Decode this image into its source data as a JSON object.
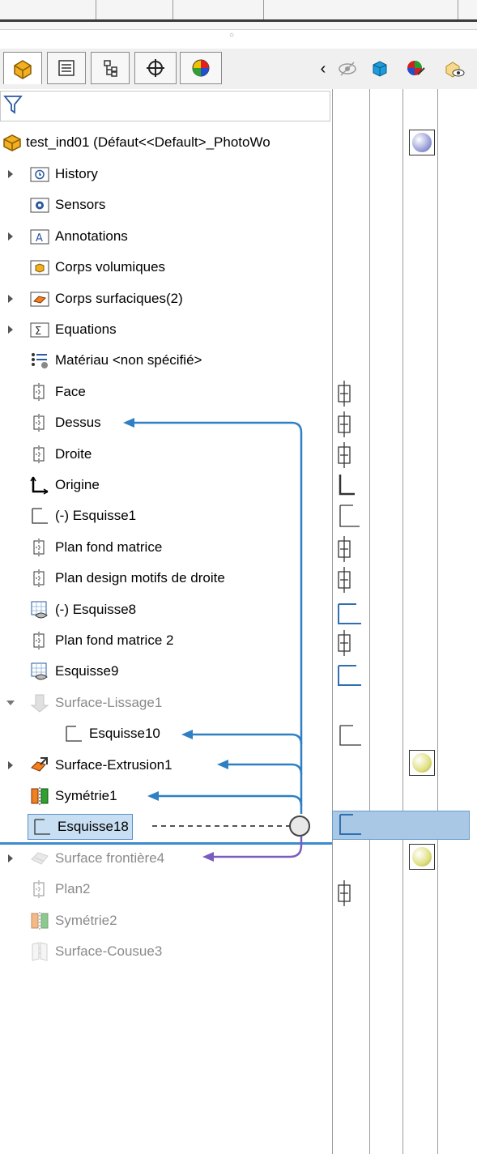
{
  "tree": {
    "root": "test_ind01  (Défaut<<Default>_PhotoWo",
    "items": [
      {
        "label": "History",
        "icon": "history-folder-icon",
        "expand": true
      },
      {
        "label": "Sensors",
        "icon": "sensors-folder-icon",
        "expand": false
      },
      {
        "label": "Annotations",
        "icon": "annotations-folder-icon",
        "expand": true
      },
      {
        "label": "Corps volumiques",
        "icon": "solid-bodies-folder-icon",
        "expand": false
      },
      {
        "label": "Corps surfaciques(2)",
        "icon": "surface-bodies-folder-icon",
        "expand": true
      },
      {
        "label": "Equations",
        "icon": "equations-folder-icon",
        "expand": true
      },
      {
        "label": "Matériau <non spécifié>",
        "icon": "material-icon",
        "expand": false
      },
      {
        "label": "Face",
        "icon": "plane-icon",
        "expand": false
      },
      {
        "label": "Dessus",
        "icon": "plane-icon",
        "expand": false
      },
      {
        "label": "Droite",
        "icon": "plane-icon",
        "expand": false
      },
      {
        "label": "Origine",
        "icon": "origin-icon",
        "expand": false
      },
      {
        "label": "(-) Esquisse1",
        "icon": "sketch-icon",
        "expand": false
      },
      {
        "label": "Plan fond matrice",
        "icon": "plane-icon",
        "expand": false
      },
      {
        "label": "Plan design motifs de droite",
        "icon": "plane-icon",
        "expand": false
      },
      {
        "label": "(-) Esquisse8",
        "icon": "sketch-3d-icon",
        "expand": false
      },
      {
        "label": "Plan fond matrice 2",
        "icon": "plane-icon",
        "expand": false
      },
      {
        "label": "Esquisse9",
        "icon": "sketch-3d-icon",
        "expand": false
      },
      {
        "label": "Surface-Lissage1",
        "icon": "surface-loft-icon",
        "expand": "open"
      },
      {
        "label": "Esquisse10",
        "icon": "sketch-icon",
        "expand": false
      },
      {
        "label": "Surface-Extrusion1",
        "icon": "surface-extrude-icon",
        "expand": true
      },
      {
        "label": "Symétrie1",
        "icon": "mirror-icon",
        "expand": false
      },
      {
        "label": "Esquisse18",
        "icon": "sketch-icon",
        "expand": false
      },
      {
        "label": "Surface frontière4",
        "icon": "boundary-surface-icon",
        "expand": true
      },
      {
        "label": "Plan2",
        "icon": "plane-icon",
        "expand": false
      },
      {
        "label": "Symétrie2",
        "icon": "mirror-icon",
        "expand": false
      },
      {
        "label": "Surface-Cousue3",
        "icon": "knit-surface-icon",
        "expand": false
      }
    ]
  },
  "colors": {
    "accent": "#3b8bd0",
    "link_arrow": "#2f7fc4",
    "purple_arrow": "#7a5cc0",
    "selection": "#c8def2"
  }
}
